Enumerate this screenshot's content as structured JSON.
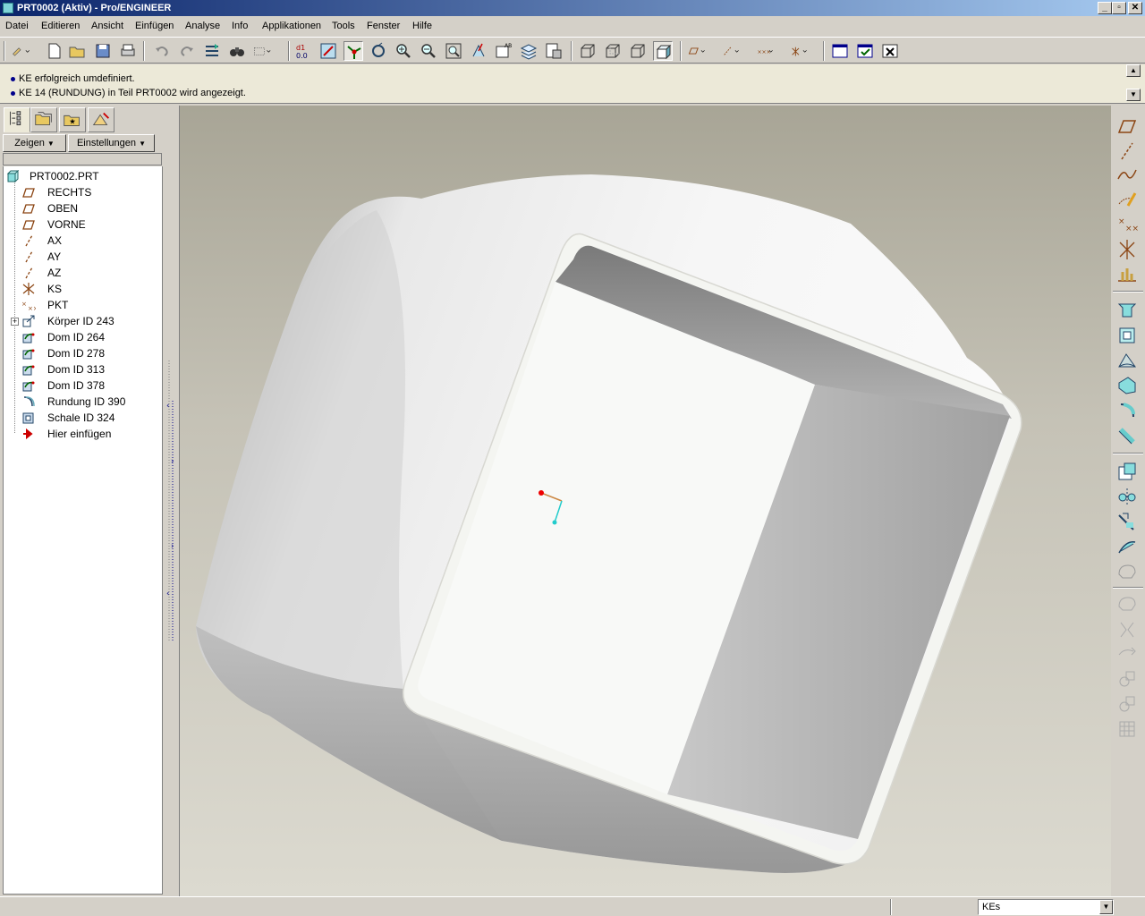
{
  "window": {
    "title": "PRT0002 (Aktiv) - Pro/ENGINEER",
    "minimize": "_",
    "maximize": "▫",
    "close": "✕"
  },
  "menu": [
    "Datei",
    "Editieren",
    "Ansicht",
    "Einfügen",
    "Analyse",
    "Info",
    "Applikationen",
    "Tools",
    "Fenster",
    "Hilfe"
  ],
  "messages": [
    "KE erfolgreich umdefiniert.",
    "KE 14 (RUNDUNG) in Teil PRT0002 wird angezeigt."
  ],
  "panel": {
    "show_button": "Zeigen",
    "settings_button": "Einstellungen",
    "tree": [
      {
        "label": "PRT0002.PRT",
        "icon": "part-icon"
      },
      {
        "label": "RECHTS",
        "icon": "datum-plane-icon"
      },
      {
        "label": "OBEN",
        "icon": "datum-plane-icon"
      },
      {
        "label": "VORNE",
        "icon": "datum-plane-icon"
      },
      {
        "label": "AX",
        "icon": "datum-axis-icon"
      },
      {
        "label": "AY",
        "icon": "datum-axis-icon"
      },
      {
        "label": "AZ",
        "icon": "datum-axis-icon"
      },
      {
        "label": "KS",
        "icon": "coordinate-system-icon"
      },
      {
        "label": "PKT",
        "icon": "datum-point-icon"
      },
      {
        "label": "Körper ID 243",
        "icon": "solid-icon"
      },
      {
        "label": "Dom ID 264",
        "icon": "dome-icon"
      },
      {
        "label": "Dom ID 278",
        "icon": "dome-icon"
      },
      {
        "label": "Dom ID 313",
        "icon": "dome-icon"
      },
      {
        "label": "Dom ID 378",
        "icon": "dome-icon"
      },
      {
        "label": "Rundung ID 390",
        "icon": "round-icon"
      },
      {
        "label": "Schale ID 324",
        "icon": "shell-icon"
      },
      {
        "label": "Hier einfügen",
        "icon": "insert-here-arrow-icon"
      }
    ]
  },
  "status": {
    "filter_value": "KEs"
  },
  "colors": {
    "title_gradient_start": "#0a246a",
    "title_gradient_end": "#a6caf0",
    "face": "#d4d0c8",
    "message_bg": "#ece9d8"
  }
}
